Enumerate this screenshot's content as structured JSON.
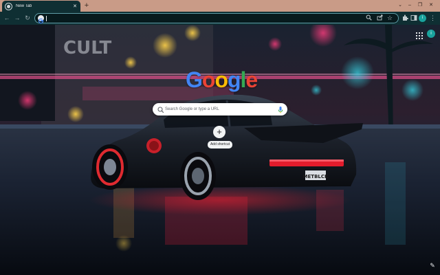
{
  "tabs": [
    {
      "title": "New Tab",
      "active": true,
      "favicon": "chrome-icon"
    }
  ],
  "tabstrip": {
    "new_tab_glyph": "+",
    "tab_close_glyph": "✕"
  },
  "window_controls": {
    "minimize": "–",
    "restore": "❐",
    "close": "✕",
    "tab_search": "⌄"
  },
  "toolbar": {
    "back": "←",
    "forward": "→",
    "reload": "↻",
    "address_value": "",
    "zoom_icon": "zoom-icon",
    "share_icon": "share-icon",
    "bookmark_glyph": "☆",
    "extensions_icon": "extensions-icon",
    "sidepanel_icon": "side-panel-icon",
    "profile_initial": "i",
    "menu_glyph": "⋮"
  },
  "ntp": {
    "logo_letters": [
      "G",
      "o",
      "o",
      "g",
      "l",
      "e"
    ],
    "search_placeholder": "Search Google or type a URL",
    "shortcut_add_label": "Add shortcut",
    "shortcut_add_glyph": "+",
    "account_initial": "i",
    "customize_glyph": "✎"
  },
  "license_plate": "METBLCK",
  "colors": {
    "tabstrip": "#c99b87",
    "toolbar": "#0f2f33",
    "omnibox_border": "#5f9ea8",
    "profile": "#1aa39d"
  }
}
